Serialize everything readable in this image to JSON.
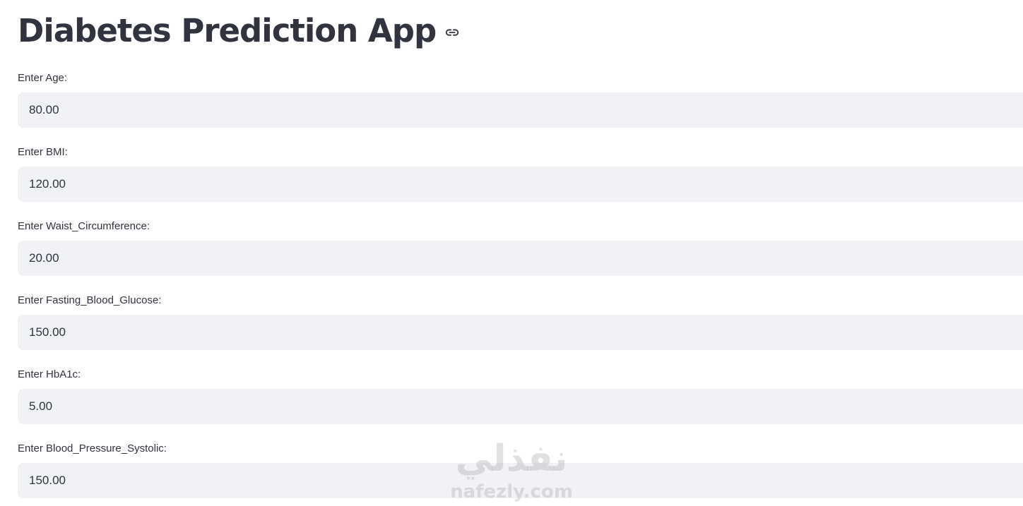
{
  "header": {
    "title": "Diabetes Prediction App",
    "anchor_icon": "link-icon"
  },
  "fields": [
    {
      "label": "Enter Age:",
      "value": "80.00"
    },
    {
      "label": "Enter BMI:",
      "value": "120.00"
    },
    {
      "label": "Enter Waist_Circumference:",
      "value": "20.00"
    },
    {
      "label": "Enter Fasting_Blood_Glucose:",
      "value": "150.00"
    },
    {
      "label": "Enter HbA1c:",
      "value": "5.00"
    },
    {
      "label": "Enter Blood_Pressure_Systolic:",
      "value": "150.00"
    }
  ],
  "watermark": {
    "arabic": "نفذلي",
    "latin": "nafezly.com"
  },
  "colors": {
    "text": "#31333f",
    "input_background": "#f0f2f6",
    "background": "#ffffff"
  }
}
